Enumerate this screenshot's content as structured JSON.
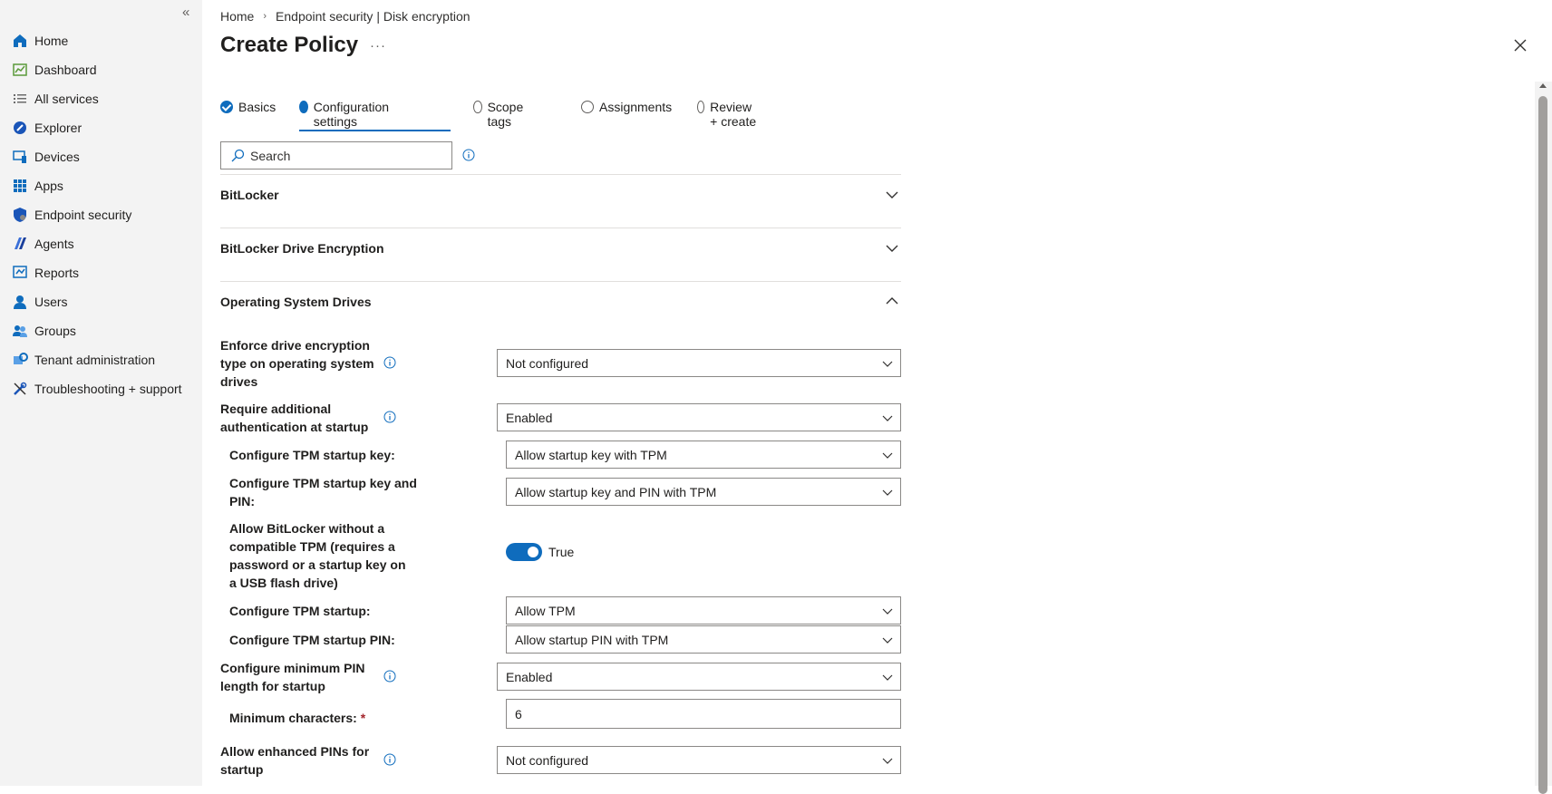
{
  "sidebar": {
    "collapse_icon": "double-chevron-left-icon",
    "items": [
      {
        "label": "Home",
        "icon": "home-icon"
      },
      {
        "label": "Dashboard",
        "icon": "dashboard-icon"
      },
      {
        "label": "All services",
        "icon": "list-icon"
      },
      {
        "label": "Explorer",
        "icon": "explorer-icon"
      },
      {
        "label": "Devices",
        "icon": "devices-icon"
      },
      {
        "label": "Apps",
        "icon": "apps-grid-icon"
      },
      {
        "label": "Endpoint security",
        "icon": "shield-icon"
      },
      {
        "label": "Agents",
        "icon": "agents-icon"
      },
      {
        "label": "Reports",
        "icon": "reports-icon"
      },
      {
        "label": "Users",
        "icon": "user-icon"
      },
      {
        "label": "Groups",
        "icon": "groups-icon"
      },
      {
        "label": "Tenant administration",
        "icon": "tenant-admin-icon"
      },
      {
        "label": "Troubleshooting + support",
        "icon": "wrench-icon"
      }
    ]
  },
  "breadcrumb": {
    "home": "Home",
    "current": "Endpoint security | Disk encryption"
  },
  "page": {
    "title": "Create Policy",
    "more": "···"
  },
  "tabs": [
    {
      "label": "Basics",
      "state": "done"
    },
    {
      "label": "Configuration settings",
      "state": "active"
    },
    {
      "label": "Scope tags",
      "state": "pending"
    },
    {
      "label": "Assignments",
      "state": "pending"
    },
    {
      "label": "Review + create",
      "state": "pending"
    }
  ],
  "search": {
    "placeholder": "Search"
  },
  "sections": {
    "bitlocker": "BitLocker",
    "drive_encryption": "BitLocker Drive Encryption",
    "os_drives": "Operating System Drives"
  },
  "settings": {
    "enforce_type": {
      "label": "Enforce drive encryption type on operating system drives",
      "value": "Not configured"
    },
    "require_auth": {
      "label": "Require additional authentication at startup",
      "value": "Enabled"
    },
    "tpm_startup_key": {
      "label": "Configure TPM startup key:",
      "value": "Allow startup key with TPM"
    },
    "tpm_startup_key_pin": {
      "label": "Configure TPM startup key and PIN:",
      "value": "Allow startup key and PIN with TPM"
    },
    "allow_without_tpm": {
      "label": "Allow BitLocker without a compatible TPM (requires a password or a startup key on a USB flash drive)",
      "value": "True"
    },
    "tpm_startup": {
      "label": "Configure TPM startup:",
      "value": "Allow TPM"
    },
    "tpm_startup_pin": {
      "label": "Configure TPM startup PIN:",
      "value": "Allow startup PIN with TPM"
    },
    "min_pin_length": {
      "label": "Configure minimum PIN length for startup",
      "value": "Enabled"
    },
    "min_chars": {
      "label": "Minimum characters:",
      "required_mark": "*",
      "value": "6"
    },
    "enhanced_pins": {
      "label": "Allow enhanced PINs for startup",
      "value": "Not configured"
    }
  }
}
